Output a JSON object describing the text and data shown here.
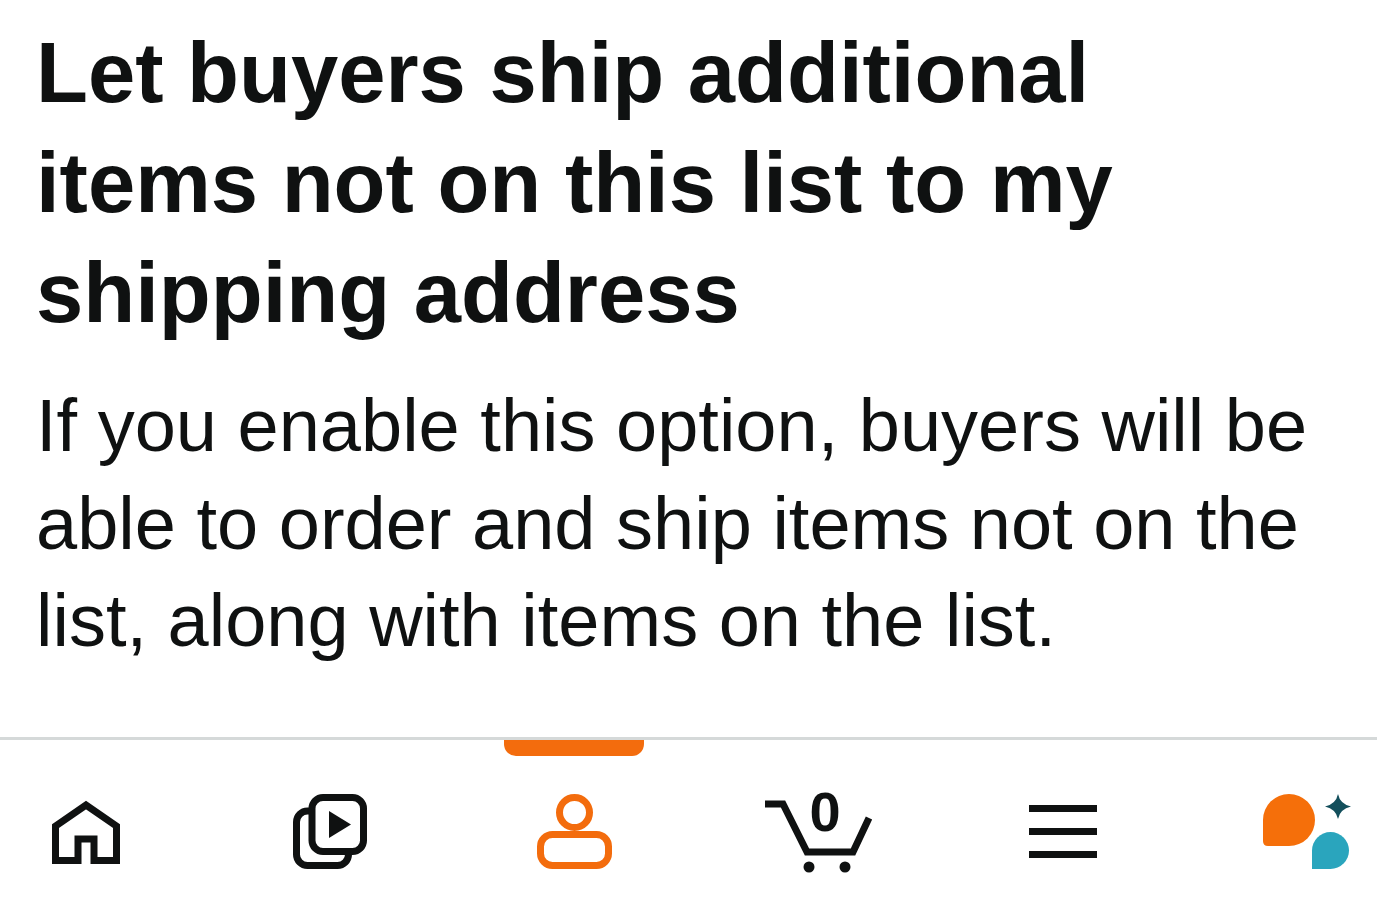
{
  "heading": "Let buyers ship additional items not on this list to my shipping address",
  "description": "If you enable this option, buyers will be able to order and ship items not on the list, along with items on the list.",
  "bottom_nav": {
    "tabs": [
      {
        "kind": "home",
        "selected": false
      },
      {
        "kind": "video",
        "selected": false
      },
      {
        "kind": "account",
        "selected": true
      },
      {
        "kind": "cart",
        "selected": false,
        "count": "0"
      },
      {
        "kind": "menu",
        "selected": false
      },
      {
        "kind": "assistant",
        "selected": false
      }
    ]
  }
}
